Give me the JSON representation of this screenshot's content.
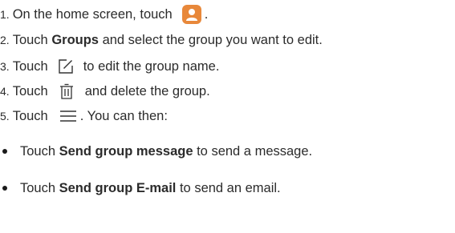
{
  "steps": [
    {
      "num": "1.",
      "pre": "On the home screen, touch",
      "icon": "contacts-app-icon",
      "post": "."
    },
    {
      "num": "2.",
      "pre": "Touch ",
      "bold": "Groups",
      "post": " and select the group you want to edit."
    },
    {
      "num": "3.",
      "pre": "Touch",
      "icon": "edit-icon",
      "post": "to edit the group name."
    },
    {
      "num": "4.",
      "pre": "Touch",
      "icon": "trash-icon",
      "post": "and delete the group."
    },
    {
      "num": "5.",
      "pre": "Touch",
      "icon": "menu-icon",
      "post": ". You can then:"
    }
  ],
  "bullets": [
    {
      "pre": "Touch ",
      "bold": "Send group message",
      "post": " to send a message."
    },
    {
      "pre": "Touch ",
      "bold": "Send group E-mail",
      "post": " to send an email."
    }
  ],
  "colors": {
    "contacts_icon_bg": "#e8883a",
    "text": "#2b2b2b"
  }
}
